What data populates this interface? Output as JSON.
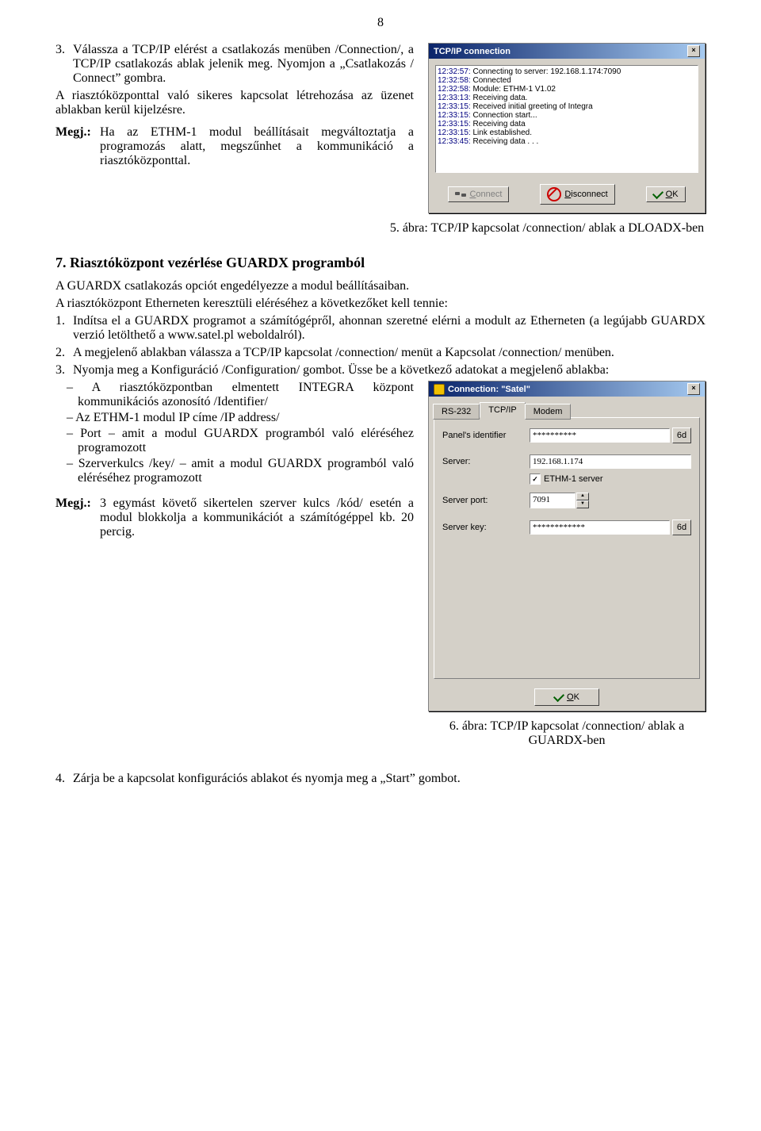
{
  "pageNumber": "8",
  "item3": {
    "num": "3.",
    "text": "Válassza a TCP/IP elérést a csatlakozás menüben /Connection/, a TCP/IP csatlakozás ablak jelenik meg. Nyomjon a „Csatlakozás / Connect” gombra."
  },
  "para1": "A riasztóközponttal való sikeres kapcsolat létrehozása az üzenet ablakban kerül kijelzésre.",
  "megj1": {
    "label": "Megj.:",
    "text": "Ha az ETHM-1 modul beállításait megváltoztatja a programozás alatt, megszűnhet a kommunikáció a riasztóközponttal."
  },
  "fig5": {
    "title": "TCP/IP connection",
    "log": [
      {
        "ts": "12:32:57:",
        "msg": "Connecting to server: 192.168.1.174:7090"
      },
      {
        "ts": "12:32:58:",
        "msg": "Connected"
      },
      {
        "ts": "12:32:58:",
        "msg": "Module: ETHM-1 V1.02"
      },
      {
        "ts": "12:33:13:",
        "msg": "Receiving data."
      },
      {
        "ts": "12:33:15:",
        "msg": "Received initial greeting of Integra"
      },
      {
        "ts": "12:33:15:",
        "msg": "Connection start..."
      },
      {
        "ts": "12:33:15:",
        "msg": "Receiving data"
      },
      {
        "ts": "12:33:15:",
        "msg": "Link established."
      },
      {
        "ts": "12:33:45:",
        "msg": "Receiving data . . ."
      }
    ],
    "connect_c": "C",
    "connect_rest": "onnect",
    "disconnect_d": "D",
    "disconnect_rest": "isconnect",
    "ok_o": "O",
    "ok_rest": "K"
  },
  "caption5": "5. ábra: TCP/IP kapcsolat /connection/ ablak a DLOADX-ben",
  "sec7": "7. Riasztóközpont vezérlése GUARDX programból",
  "para2": "A GUARDX csatlakozás opciót engedélyezze a modul beállításaiban.",
  "para3": "A riasztóközpont Etherneten keresztüli eléréséhez a következőket kell tennie:",
  "steps": {
    "s1": {
      "num": "1.",
      "text": "Indítsa el a GUARDX programot a számítógépről, ahonnan szeretné elérni a modult az Etherneten (a legújabb GUARDX verzió letölthető a www.satel.pl weboldalról)."
    },
    "s2": {
      "num": "2.",
      "text": "A megjelenő ablakban válassza a TCP/IP kapcsolat /connection/ menüt a Kapcsolat /connection/ menüben."
    },
    "s3": {
      "num": "3.",
      "text": "Nyomja meg a Konfiguráció /Configuration/ gombot. Üsse be a következő adatokat a megjelenő ablakba:"
    }
  },
  "bullets": [
    "A riasztóközpontban elmentett INTEGRA központ kommunikációs azonosító /Identifier/",
    "Az ETHM-1 modul IP címe /IP address/",
    "Port – amit a modul GUARDX programból való eléréséhez programozott",
    "Szerverkulcs /key/ – amit a modul GUARDX programból való eléréséhez programozott"
  ],
  "megj2": {
    "label": "Megj.:",
    "text": "3 egymást követő sikertelen szerver kulcs /kód/ esetén a modul blokkolja a kommunikációt a számítógéppel kb. 20 percig."
  },
  "fig6": {
    "title": "Connection: \"Satel\"",
    "tab_rs": "RS-232",
    "tab_tcp": "TCP/IP",
    "tab_modem": "Modem",
    "lbl_id": "Panel's identifier",
    "val_id": "**********",
    "lbl_srv": "Server:",
    "val_srv": "192.168.1.174",
    "cb_e": "ETHM-1 server",
    "cb_chk": "✓",
    "lbl_port": "Server port:",
    "val_port": "7091",
    "lbl_key": "Server key:",
    "val_key": "************",
    "ok_o": "O",
    "ok_rest": "K",
    "eye": "6d"
  },
  "caption6": "6. ábra: TCP/IP kapcsolat /connection/ ablak a GUARDX-ben",
  "step4": {
    "num": "4.",
    "text": "Zárja be a kapcsolat konfigurációs ablakot és nyomja meg a „Start” gombot."
  }
}
